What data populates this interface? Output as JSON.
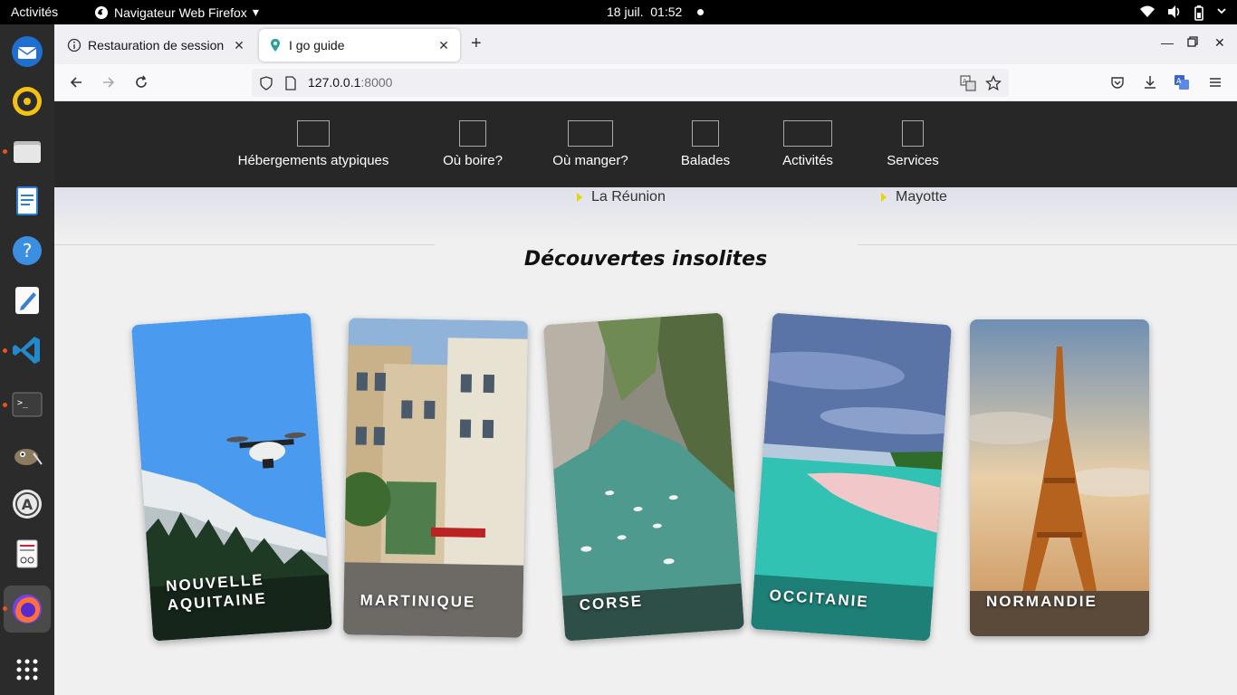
{
  "topbar": {
    "activities": "Activités",
    "app_menu": "Navigateur Web Firefox",
    "date": "18 juil.",
    "time": "01:52"
  },
  "browser": {
    "tabs": [
      {
        "title": "Restauration de session"
      },
      {
        "title": "I go guide"
      }
    ],
    "url_host": "127.0.0.1",
    "url_port": ":8000"
  },
  "site": {
    "nav": [
      "Hébergements atypiques",
      "Où boire?",
      "Où manger?",
      "Balades",
      "Activités",
      "Services"
    ],
    "regions": [
      "La Réunion",
      "Mayotte"
    ],
    "section_title": "Découvertes insolites",
    "cards": [
      {
        "label_line1": "NOUVELLE",
        "label_line2": "AQUITAINE"
      },
      {
        "label_line1": "MARTINIQUE"
      },
      {
        "label_line1": "CORSE"
      },
      {
        "label_line1": "OCCITANIE"
      },
      {
        "label_line1": "NORMANDIE"
      }
    ]
  },
  "colors": {
    "site_header_bg": "#272727",
    "region_bullet": "#e8d400",
    "dock_bg": "#2b2b2b",
    "running_indicator": "#e95420"
  }
}
